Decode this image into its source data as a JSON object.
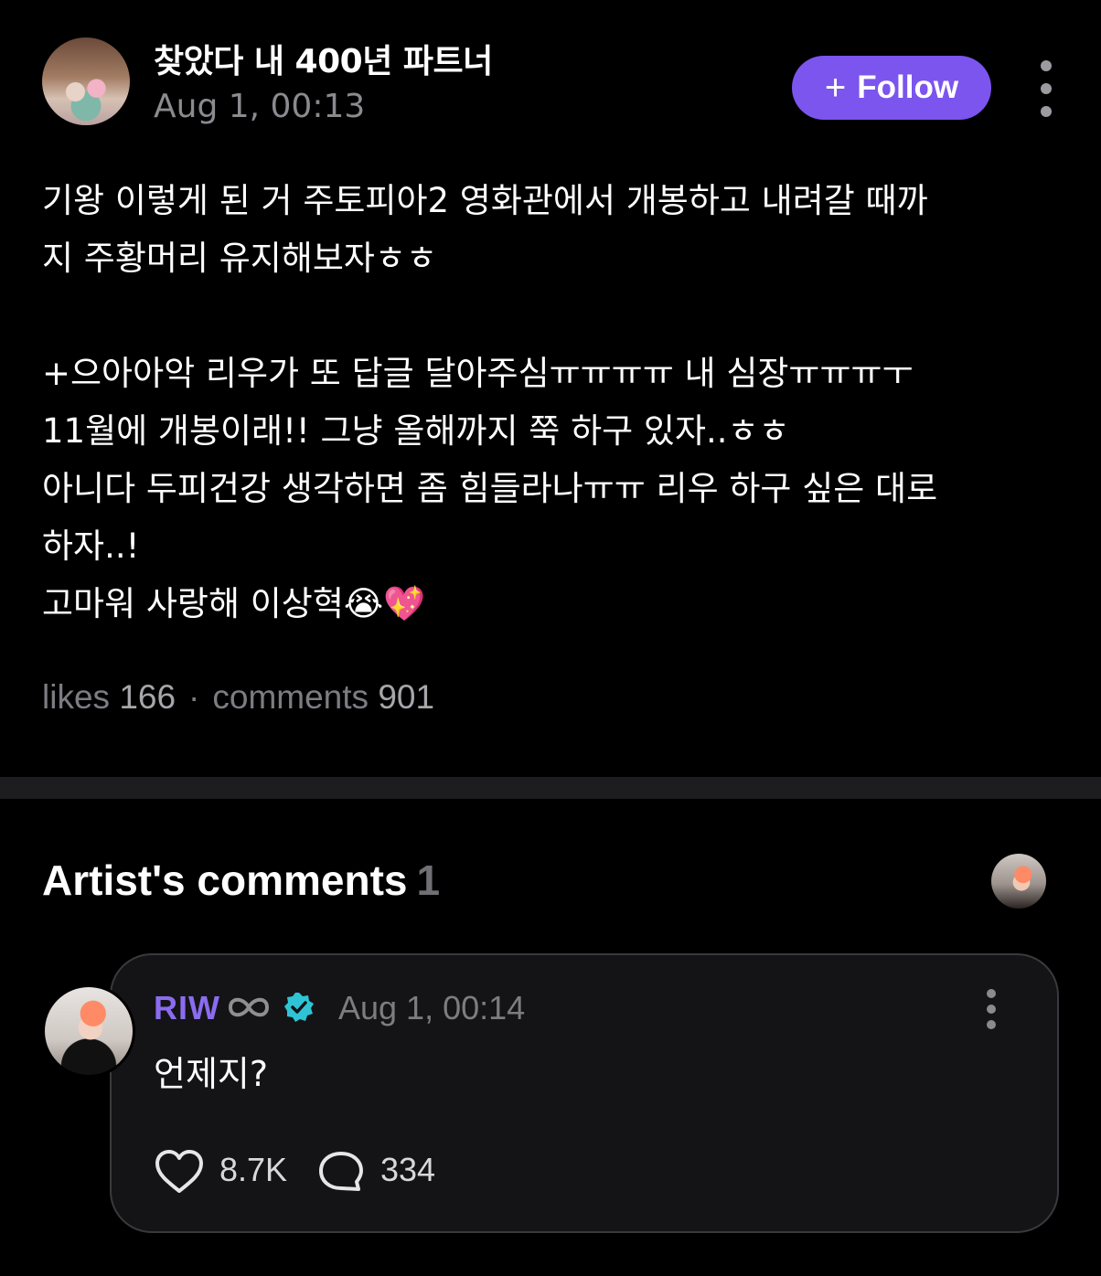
{
  "post": {
    "author_name": "찾았다 내 400년 파트너",
    "timestamp": "Aug 1, 00:13",
    "follow_label": "Follow",
    "follow_icon": "plus-icon",
    "body": "기왕 이렇게 된 거 주토피아2 영화관에서 개봉하고 내려갈 때까\n지 주황머리 유지해보자ㅎㅎ\n\n+으아아악 리우가 또 답글 달아주심ㅠㅠㅠㅠ 내 심장ㅠㅠㅠㅜ\n11월에 개봉이래!! 그냥 올해까지 쭉 하구 있자..ㅎㅎ\n아니다 두피건강 생각하면 좀 힘들라나ㅠㅠ 리우 하구 싶은 대로\n하자..!\n고마워 사랑해 이상혁😭💖",
    "stats": {
      "likes_label": "likes",
      "likes_count": "166",
      "separator": "·",
      "comments_label": "comments",
      "comments_count": "901"
    }
  },
  "artist_comments": {
    "title": "Artist's comments",
    "count": "1",
    "comment": {
      "author": "RIW",
      "author_suffix_icon": "infinity-icon",
      "verified_icon": "verified-badge-icon",
      "timestamp": "Aug 1, 00:14",
      "text": "언제지?",
      "likes": "8.7K",
      "replies": "334"
    }
  },
  "colors": {
    "background": "#000000",
    "accent_purple": "#7b55ee",
    "artist_name": "#8b6cf0",
    "verified": "#2ec4d6",
    "muted_text": "#7c7c82"
  }
}
